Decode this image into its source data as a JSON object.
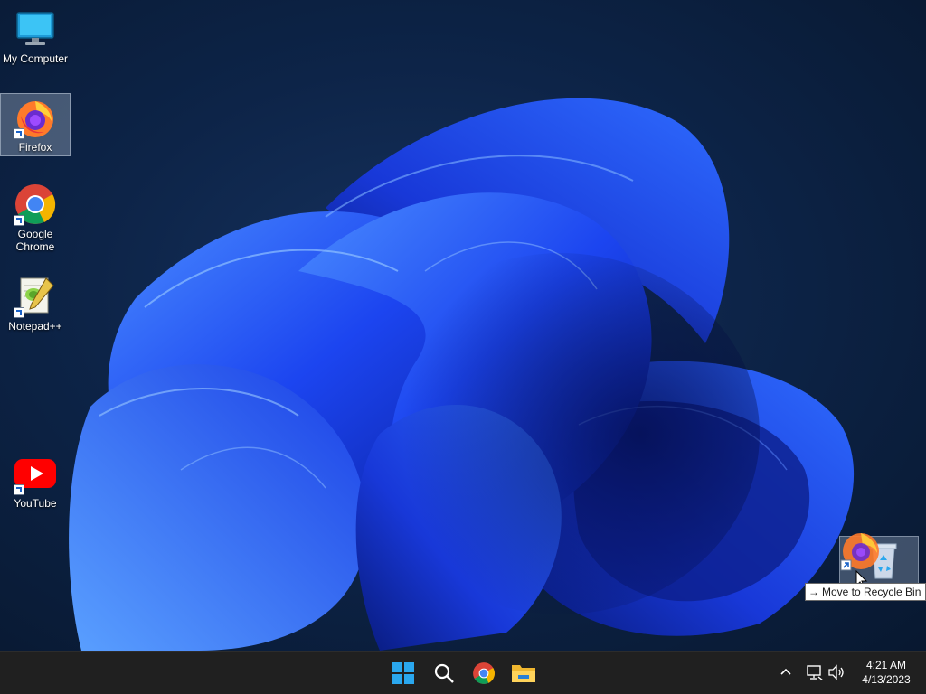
{
  "desktop": {
    "icons": [
      {
        "label": "My Computer",
        "icon": "monitor-icon"
      },
      {
        "label": "Firefox",
        "icon": "firefox-icon",
        "selected": true
      },
      {
        "label": "Google Chrome",
        "icon": "chrome-icon"
      },
      {
        "label": "Notepad++",
        "icon": "notepadpp-icon"
      },
      {
        "label": "YouTube",
        "icon": "youtube-icon"
      }
    ],
    "recycle_bin": {
      "icon": "recycle-bin-icon"
    },
    "drag_tooltip": {
      "arrow": "→",
      "text": "Move to Recycle Bin"
    }
  },
  "taskbar": {
    "buttons": [
      {
        "name": "start",
        "icon": "windows-logo-icon"
      },
      {
        "name": "search",
        "icon": "search-icon"
      },
      {
        "name": "chrome",
        "icon": "chrome-icon"
      },
      {
        "name": "file-explorer",
        "icon": "folder-icon"
      }
    ],
    "tray": {
      "icons": [
        "chevron-up-icon",
        "network-icon",
        "volume-icon"
      ]
    },
    "clock": {
      "time": "4:21 AM",
      "date": "4/13/2023"
    }
  },
  "colors": {
    "wallpaper_bg": "#0d2448",
    "bloom_blue": "#1f4bff",
    "taskbar": "#202020",
    "windows_blue": "#2aa7ee"
  }
}
